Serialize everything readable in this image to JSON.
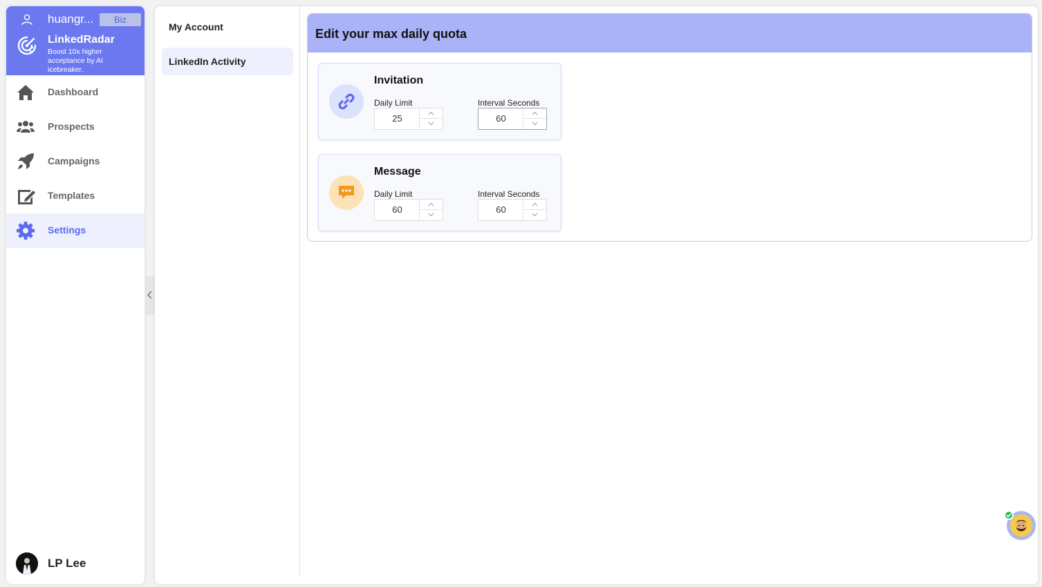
{
  "sidebar": {
    "username": "huangr...",
    "plan_badge": "Biz",
    "brand_name": "LinkedRadar",
    "brand_tagline": "Boost 10x higher acceptance by AI icebreaker.",
    "nav": [
      {
        "label": "Dashboard",
        "icon": "home-icon"
      },
      {
        "label": "Prospects",
        "icon": "users-icon"
      },
      {
        "label": "Campaigns",
        "icon": "rocket-icon"
      },
      {
        "label": "Templates",
        "icon": "edit-icon"
      },
      {
        "label": "Settings",
        "icon": "gear-icon",
        "active": true
      }
    ],
    "profile_name": "LP Lee"
  },
  "submenu": {
    "items": [
      {
        "label": "My Account"
      },
      {
        "label": "LinkedIn Activity",
        "active": true
      }
    ]
  },
  "quota": {
    "title": "Edit your max daily quota",
    "cards": [
      {
        "title": "Invitation",
        "icon": "link-icon",
        "daily_limit_label": "Daily Limit",
        "daily_limit": "25",
        "interval_label": "Interval Seconds",
        "interval": "60"
      },
      {
        "title": "Message",
        "icon": "chat-icon",
        "daily_limit_label": "Daily Limit",
        "daily_limit": "60",
        "interval_label": "Interval Seconds",
        "interval": "60"
      }
    ]
  },
  "colors": {
    "accent": "#6b78f0",
    "header": "#aab3f7",
    "active_bg": "#eef0fd",
    "invite_icon_bg": "#dbe2fb",
    "message_icon_bg": "#fde2b8"
  }
}
